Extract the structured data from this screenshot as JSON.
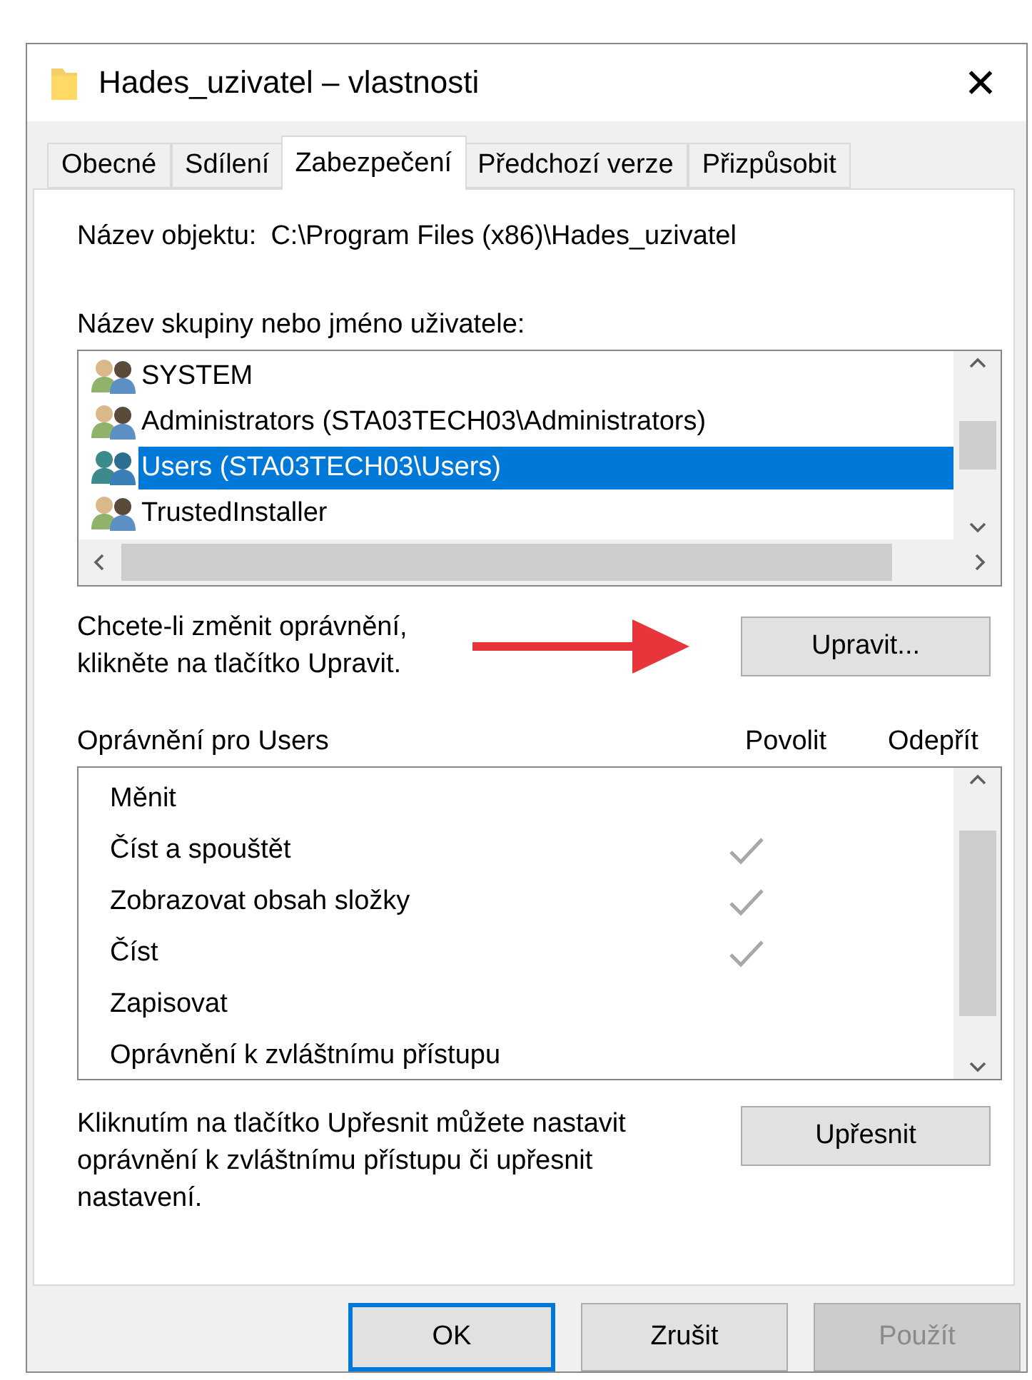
{
  "window": {
    "title": "Hades_uzivatel – vlastnosti",
    "close": "✕"
  },
  "tabs": [
    {
      "label": "Obecné",
      "selected": false
    },
    {
      "label": "Sdílení",
      "selected": false
    },
    {
      "label": "Zabezpečení",
      "selected": true
    },
    {
      "label": "Předchozí verze",
      "selected": false
    },
    {
      "label": "Přizpůsobit",
      "selected": false
    }
  ],
  "object_name": {
    "label": "Název objektu:",
    "value": "C:\\Program Files (x86)\\Hades_uzivatel"
  },
  "groups": {
    "label": "Název skupiny nebo jméno uživatele:",
    "items": [
      {
        "name": "SYSTEM",
        "selected": false
      },
      {
        "name": "Administrators (STA03TECH03\\Administrators)",
        "selected": false
      },
      {
        "name": "Users (STA03TECH03\\Users)",
        "selected": true
      },
      {
        "name": "TrustedInstaller",
        "selected": false
      }
    ]
  },
  "edit_hint": [
    "Chcete-li změnit oprávnění,",
    "klikněte na tlačítko Upravit."
  ],
  "edit_button": "Upravit...",
  "permissions": {
    "label": "Oprávnění pro Users",
    "allow_label": "Povolit",
    "deny_label": "Odepřít",
    "rows": [
      {
        "name": "Měnit",
        "allow": false
      },
      {
        "name": "Číst a spouštět",
        "allow": true
      },
      {
        "name": "Zobrazovat obsah složky",
        "allow": true
      },
      {
        "name": "Číst",
        "allow": true
      },
      {
        "name": "Zapisovat",
        "allow": false
      },
      {
        "name": "Oprávnění k zvláštnímu přístupu",
        "allow": false
      }
    ]
  },
  "advanced_hint": "Kliknutím na tlačítko Upřesnit můžete nastavit oprávnění k zvláštnímu přístupu či upřesnit nastavení.",
  "advanced_button": "Upřesnit",
  "buttons": [
    {
      "label": "OK",
      "default": true,
      "disabled": false
    },
    {
      "label": "Zrušit",
      "default": false,
      "disabled": false
    },
    {
      "label": "Použít",
      "default": false,
      "disabled": true
    }
  ]
}
